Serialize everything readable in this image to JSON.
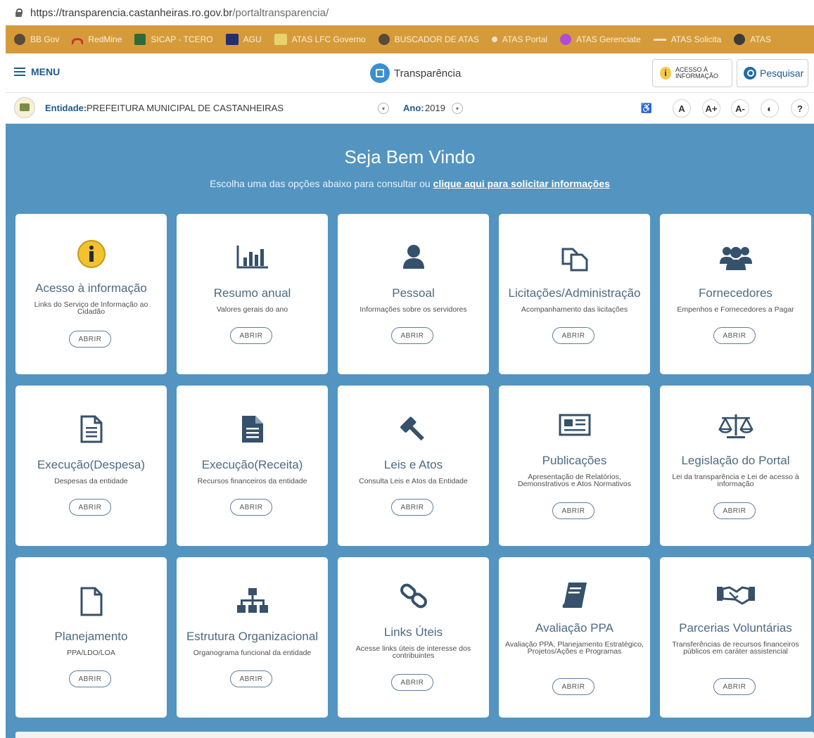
{
  "browser": {
    "url_host": "https://transparencia.castanheiras.ro.gov.br",
    "url_path": "/portaltransparencia/",
    "bookmarks": [
      "BB Gov",
      "RedMine",
      "SICAP - TCERO",
      "AGU",
      "ATAS LFC Governo",
      "BUSCADOR DE ATAS",
      "ATAS Portal",
      "ATAS Gerenciate",
      "ATAS Solicita",
      "ATAS"
    ]
  },
  "navbar": {
    "menu_label": "MENU",
    "brand": "Transparência",
    "acesso_line1": "ACESSO À",
    "acesso_line2": "INFORMAÇÃO",
    "search_label": "Pesquisar"
  },
  "entity_bar": {
    "entidade_label": "Entidade:",
    "entidade_value": "PREFEITURA MUNICIPAL DE CASTANHEIRAS",
    "ano_label": "Ano:",
    "ano_value": "2019",
    "tools": [
      "A",
      "A+",
      "A-",
      "?"
    ]
  },
  "hero": {
    "title": "Seja Bem Vindo",
    "subtitle": "Escolha uma das opções abaixo para consultar ou",
    "subtitle_link": "clique aqui para solicitar informações"
  },
  "button_label": "ABRIR",
  "cards": [
    {
      "title": "Acesso à informação",
      "desc": "Links do Serviço de Informação ao Cidadão",
      "icon": "info-icon"
    },
    {
      "title": "Resumo anual",
      "desc": "Valores gerais do ano",
      "icon": "bar-chart-icon"
    },
    {
      "title": "Pessoal",
      "desc": "Informações sobre os servidores",
      "icon": "user-icon"
    },
    {
      "title": "Licitações/Administração",
      "desc": "Acompanhamento das licitações",
      "icon": "documents-icon"
    },
    {
      "title": "Fornecedores",
      "desc": "Empenhos e Fornecedores a Pagar",
      "icon": "users-group-icon"
    },
    {
      "title": "Execução(Despesa)",
      "desc": "Despesas da entidade",
      "icon": "file-text-outline-icon"
    },
    {
      "title": "Execução(Receita)",
      "desc": "Recursos financeiros da entidade",
      "icon": "file-text-solid-icon"
    },
    {
      "title": "Leis e Atos",
      "desc": "Consulta Leis e Atos da Entidade",
      "icon": "gavel-icon"
    },
    {
      "title": "Publicações",
      "desc": "Apresentação de Relatórios, Demonstrativos e Atos Normativos",
      "icon": "newspaper-icon"
    },
    {
      "title": "Legislação do Portal",
      "desc": "Lei da transparência e Lei de acesso à informação",
      "icon": "balance-scale-icon"
    },
    {
      "title": "Planejamento",
      "desc": "PPA/LDO/LOA",
      "icon": "file-outline-icon"
    },
    {
      "title": "Estrutura Organizacional",
      "desc": "Organograma funcional da entidade",
      "icon": "org-chart-icon"
    },
    {
      "title": "Links Úteis",
      "desc": "Acesse links úteis de interesse dos contribuintes",
      "icon": "chain-link-icon"
    },
    {
      "title": "Avaliação PPA",
      "desc": "Avaliação PPA, Planejamento Estratégico, Projetos/Ações e Programas",
      "icon": "book-icon"
    },
    {
      "title": "Parcerias Voluntárias",
      "desc": "Transferências de recursos financeiros públicos em caráter assistencial",
      "icon": "handshake-icon"
    }
  ]
}
